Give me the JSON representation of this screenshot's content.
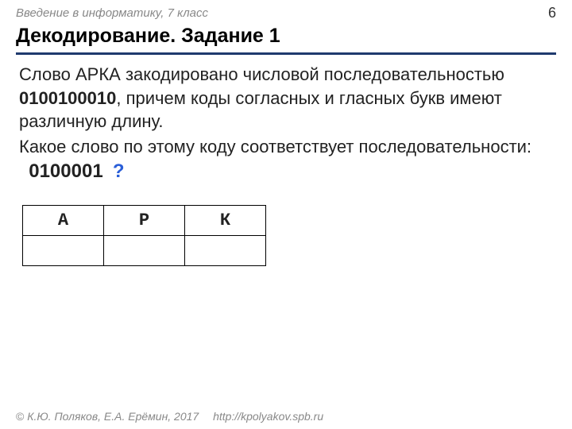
{
  "header": {
    "breadcrumb": "Введение в информатику, 7 класс",
    "page_number": "6"
  },
  "title": "Декодирование. Задание 1",
  "body": {
    "p1_a": "Слово АРКА закодировано числовой последовательностью ",
    "p1_code": "0100100010",
    "p1_b": ", причем коды согласных и гласных букв имеют различную длину.",
    "p2": "Какое слово по этому коду соответствует последовательности:",
    "q_code": "0100001",
    "q_mark": "?"
  },
  "table": {
    "headers": [
      "А",
      "Р",
      "К"
    ],
    "cells": [
      "",
      "",
      ""
    ]
  },
  "footer": {
    "copyright_symbol": "©",
    "authors": "К.Ю. Поляков, Е.А. Ерёмин, 2017",
    "url": "http://kpolyakov.spb.ru"
  }
}
